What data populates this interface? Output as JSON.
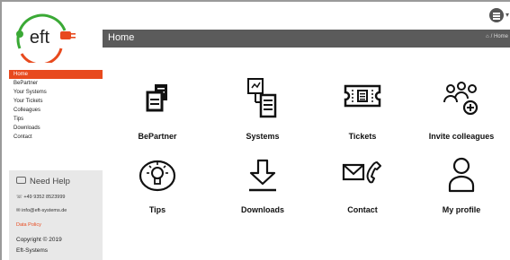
{
  "logo": {
    "text": "eft"
  },
  "header": {
    "title": "Home",
    "breadcrumb": "/ Home"
  },
  "sidebar": {
    "items": [
      {
        "label": "Home",
        "active": true
      },
      {
        "label": "BePartner"
      },
      {
        "label": "Your Systems"
      },
      {
        "label": "Your Tickets"
      },
      {
        "label": "Colleagues"
      },
      {
        "label": "Tips"
      },
      {
        "label": "Downloads"
      },
      {
        "label": "Contact"
      }
    ]
  },
  "help": {
    "title": "Need Help",
    "phone": "+49 9352 8523999",
    "email": "info@eft-systems.de",
    "data_policy": "Data Policy",
    "copyright": "Copyright © 2019",
    "company": "Eft-Systems"
  },
  "tiles": [
    {
      "label": "BePartner",
      "icon": "partner-icon"
    },
    {
      "label": "Systems",
      "icon": "systems-icon"
    },
    {
      "label": "Tickets",
      "icon": "ticket-icon"
    },
    {
      "label": "Invite colleagues",
      "icon": "invite-colleagues-icon"
    },
    {
      "label": "Tips",
      "icon": "lightbulb-icon"
    },
    {
      "label": "Downloads",
      "icon": "download-icon"
    },
    {
      "label": "Contact",
      "icon": "contact-icon"
    },
    {
      "label": "My profile",
      "icon": "profile-icon"
    }
  ],
  "colors": {
    "accent": "#e84a1e",
    "header": "#5b5b5b",
    "logo_green": "#3aa935"
  }
}
